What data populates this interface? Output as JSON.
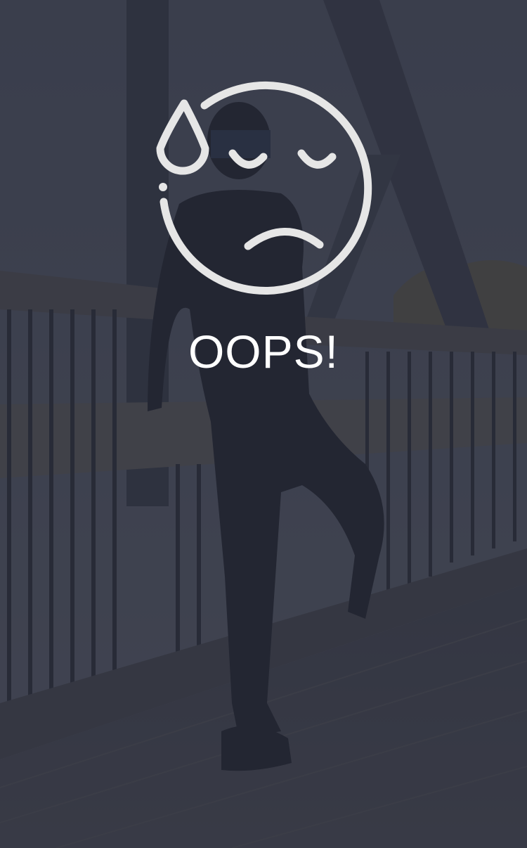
{
  "error_screen": {
    "title": "OOPS!",
    "icon": "sad-face-sweat-icon",
    "background": "runner-stretching-on-bridge-photo"
  },
  "colors": {
    "overlay": "#262a38",
    "icon_stroke": "#e6e6e6",
    "title": "#ffffff"
  }
}
